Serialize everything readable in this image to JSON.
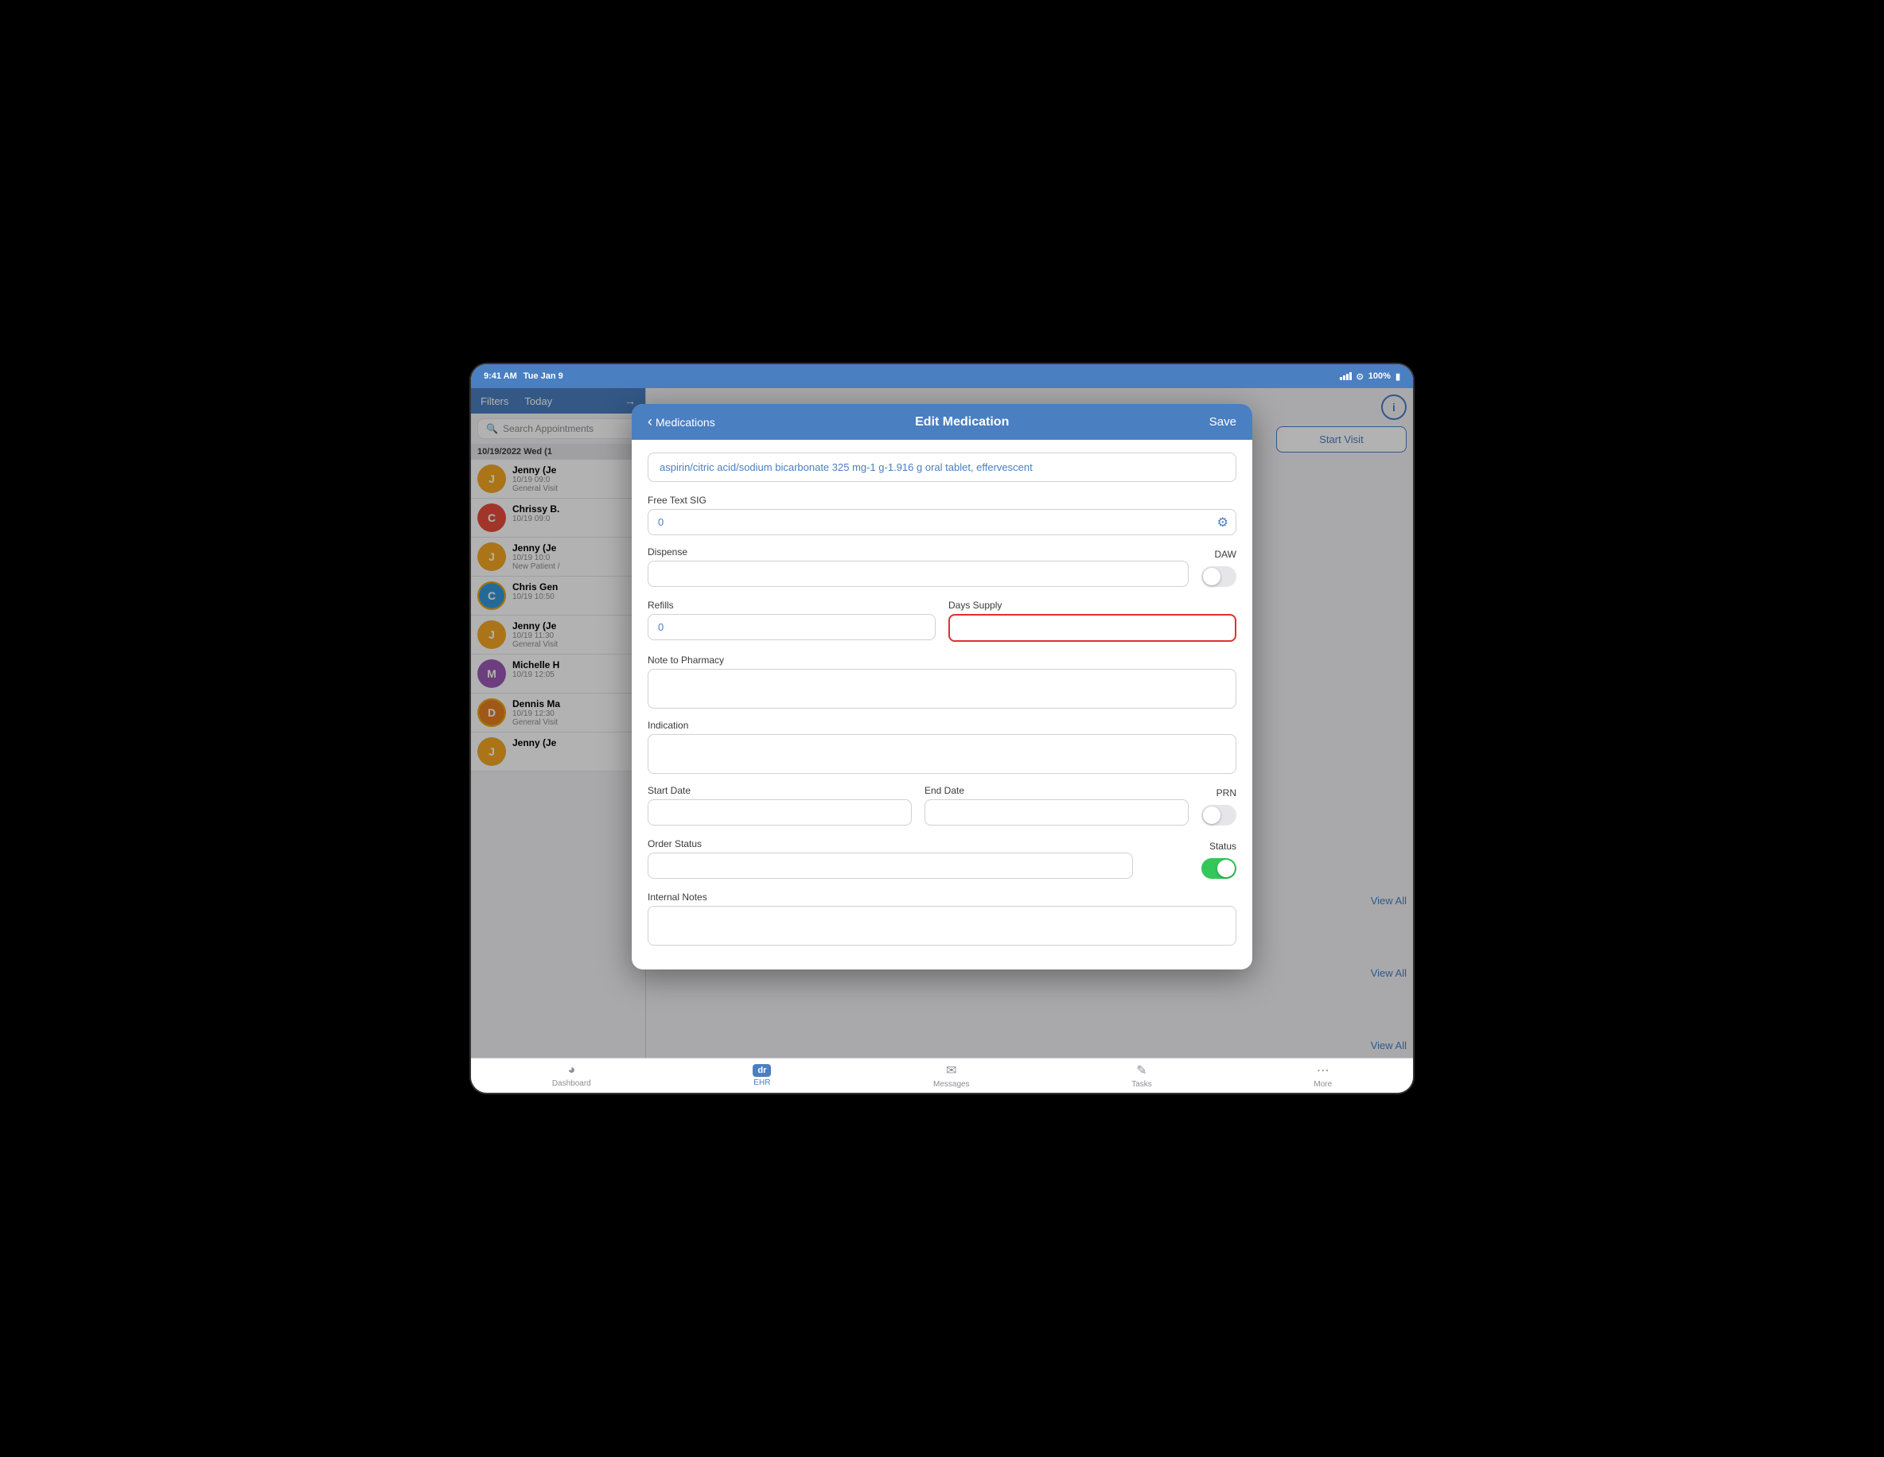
{
  "statusBar": {
    "time": "9:41 AM",
    "day": "Tue Jan 9",
    "battery": "100%"
  },
  "header": {
    "filtersLabel": "Filters",
    "todayLabel": "Today"
  },
  "search": {
    "placeholder": "Search Appointments"
  },
  "dateGroup": {
    "label": "10/19/2022 Wed (1"
  },
  "patients": [
    {
      "name": "Jenny (Je",
      "time": "10/19 09:0",
      "type": "General Visit",
      "initials": "J",
      "color": "#f5a623",
      "ring": false
    },
    {
      "name": "Chrissy B.",
      "time": "10/19 09:0",
      "type": "",
      "initials": "C",
      "color": "#e74c3c",
      "ring": false
    },
    {
      "name": "Jenny (Je",
      "time": "10/19 10:0",
      "type": "New Patient /",
      "initials": "J",
      "color": "#f5a623",
      "ring": false
    },
    {
      "name": "Chris Gen",
      "time": "10/19 10:50",
      "type": "",
      "initials": "C",
      "color": "#3498db",
      "ring": true
    },
    {
      "name": "Jenny (Je",
      "time": "10/19 11:30",
      "type": "General Visit",
      "initials": "J",
      "color": "#f5a623",
      "ring": false
    },
    {
      "name": "Michelle H",
      "time": "10/19 12:05",
      "type": "",
      "initials": "M",
      "color": "#9b59b6",
      "ring": false
    },
    {
      "name": "Dennis Ma",
      "time": "10/19 12:30",
      "type": "General Visit",
      "initials": "D",
      "color": "#e67e22",
      "ring": true
    },
    {
      "name": "Jenny (Je",
      "time": "",
      "type": "",
      "initials": "J",
      "color": "#f5a623",
      "ring": false
    }
  ],
  "rightPanel": {
    "startVisitLabel": "Start Visit",
    "viewAllLabel": "View All"
  },
  "modal": {
    "backLabel": "Medications",
    "title": "Edit Medication",
    "saveLabel": "Save",
    "drugName": "aspirin/citric acid/sodium bicarbonate 325 mg-1 g-1.916 g oral tablet, effervescent",
    "freeSigLabel": "Free Text SIG",
    "freeSigValue": "0",
    "dispenseLabel": "Dispense",
    "dawLabel": "DAW",
    "refillsLabel": "Refills",
    "refillsValue": "0",
    "daysSupplyLabel": "Days Supply",
    "daysSupplyValue": "",
    "noteToPharmacyLabel": "Note to Pharmacy",
    "noteToPharmacyValue": "",
    "indicationLabel": "Indication",
    "indicationValue": "",
    "startDateLabel": "Start Date",
    "startDateValue": "",
    "endDateLabel": "End Date",
    "endDateValue": "",
    "prnLabel": "PRN",
    "orderStatusLabel": "Order Status",
    "orderStatusValue": "",
    "statusLabel": "Status",
    "internalNotesLabel": "Internal Notes",
    "internalNotesValue": ""
  },
  "tabBar": {
    "dashboard": "Dashboard",
    "ehr": "EHR",
    "messages": "Messages",
    "tasks": "Tasks",
    "more": "More"
  }
}
